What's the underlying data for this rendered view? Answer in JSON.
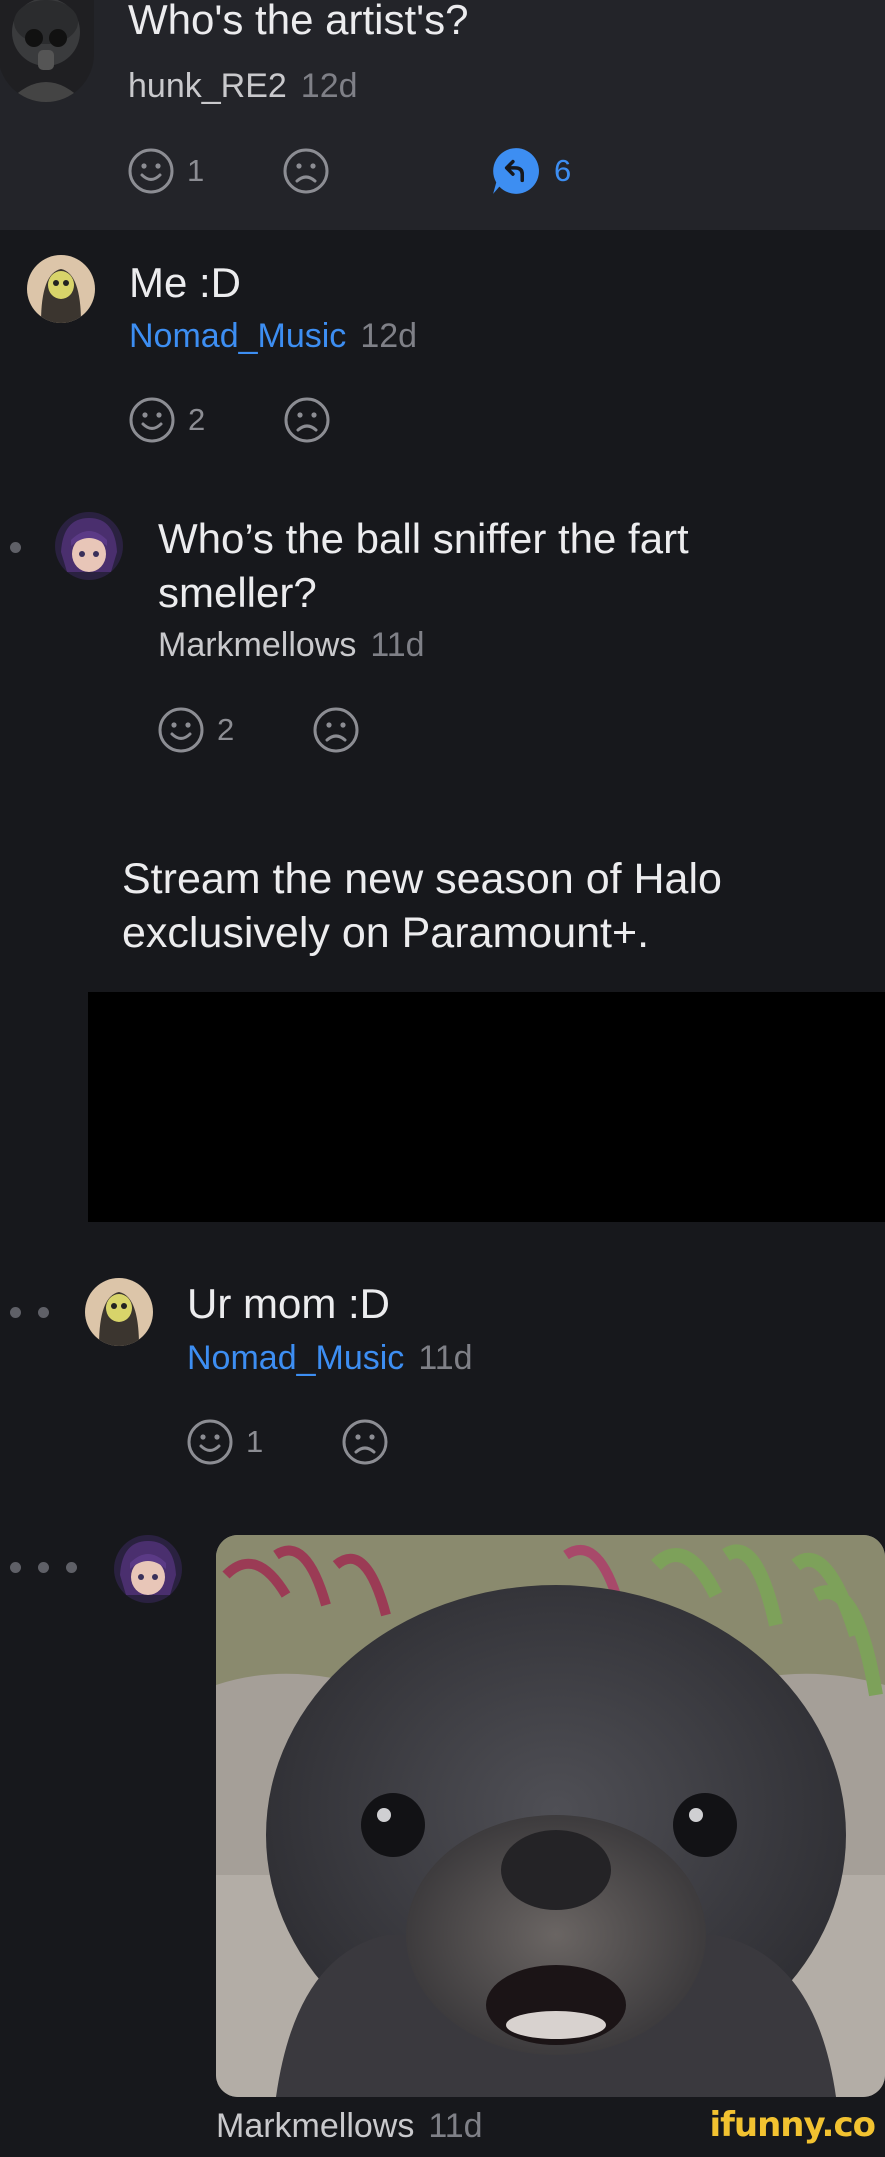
{
  "comments": [
    {
      "text": "Who's the artist's?",
      "user": "hunk_RE2",
      "age": "12d",
      "likes": "1",
      "replies": "6",
      "avatar_icon": "gas-mask-soldier-avatar"
    },
    {
      "text": "Me :D",
      "user": "Nomad_Music",
      "age": "12d",
      "likes": "2",
      "avatar_icon": "hooded-figure-avatar"
    },
    {
      "text_line1": "Who’s the ball sniffer the fart",
      "text_line2": "smeller?",
      "user": "Markmellows",
      "age": "11d",
      "likes": "2",
      "avatar_icon": "anime-girl-avatar"
    },
    {
      "text": "Ur mom :D",
      "user": "Nomad_Music",
      "age": "11d",
      "likes": "1",
      "avatar_icon": "hooded-figure-avatar"
    },
    {
      "user": "Markmellows",
      "age": "11d",
      "avatar_icon": "anime-girl-avatar",
      "image": "sea-lion-pup-photo"
    }
  ],
  "ad": {
    "line1": "Stream the new season of Halo",
    "line2": "exclusively on Paramount+."
  },
  "watermark": "ifunny.co",
  "colors": {
    "background": "#17181c",
    "highlight_band": "#232429",
    "link": "#3d8ef2",
    "muted": "#7f8087",
    "watermark": "#f2c230"
  }
}
